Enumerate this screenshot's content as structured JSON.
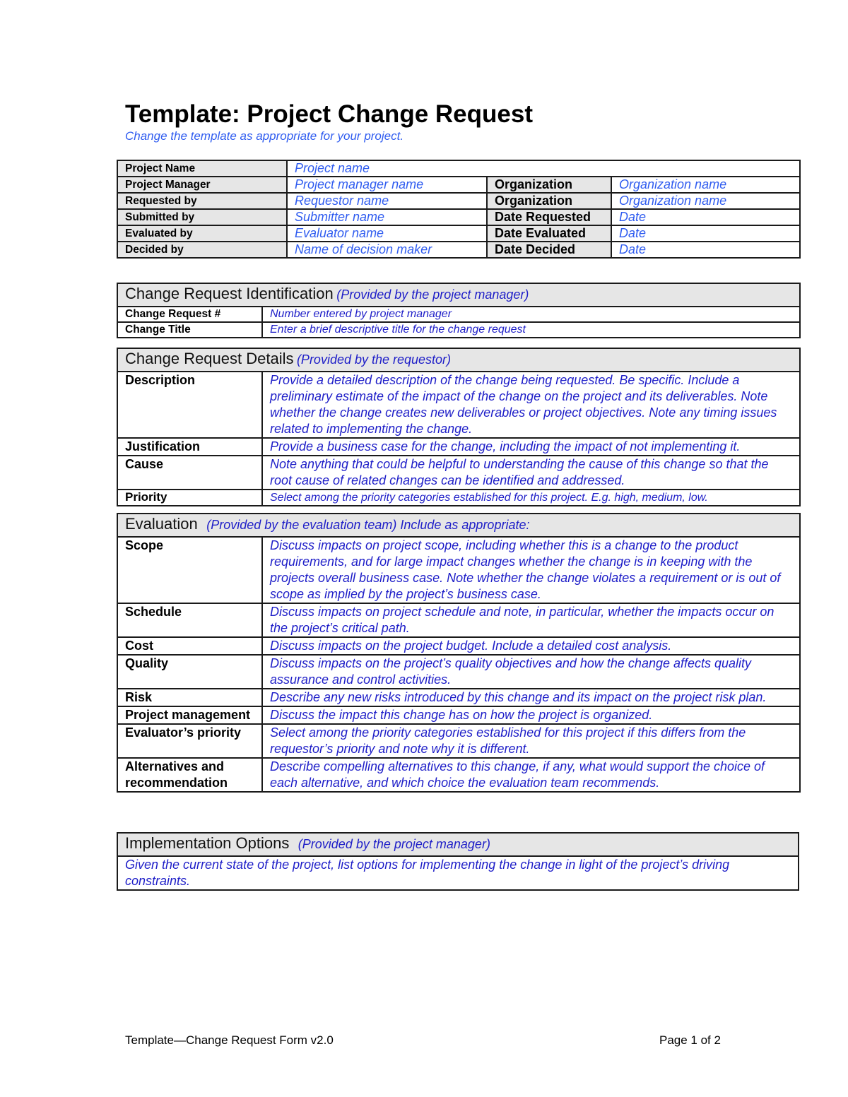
{
  "document": {
    "title": "Template: Project Change Request",
    "subtitle": "Change the template as appropriate for your project."
  },
  "colors": {
    "header_value_blue": "#2f5cf0",
    "section_value_blue": "#1e1ec8",
    "label_background": "#e6e6e6",
    "border": "#1a1a1a"
  },
  "header_table": {
    "project_name_label": "Project Name",
    "project_name_value": "Project name",
    "rows": [
      {
        "label": "Project Manager",
        "value": "Project manager name",
        "label2": "Organization",
        "value2": "Organization name"
      },
      {
        "label": "Requested by",
        "value": "Requestor name",
        "label2": "Organization",
        "value2": "Organization name"
      },
      {
        "label": "Submitted by",
        "value": "Submitter name",
        "label2": "Date Requested",
        "value2": "Date"
      },
      {
        "label": "Evaluated by",
        "value": "Evaluator name",
        "label2": "Date Evaluated",
        "value2": "Date"
      },
      {
        "label": "Decided by",
        "value": "Name of decision maker",
        "label2": "Date Decided",
        "value2": "Date"
      }
    ]
  },
  "sections": {
    "identification": {
      "title": "Change Request Identification",
      "note": "(Provided by the project manager)",
      "rows": [
        {
          "label": "Change Request #",
          "value": "Number entered by project manager"
        },
        {
          "label": "Change Title",
          "value": "Enter a brief descriptive title for the change request"
        }
      ]
    },
    "details": {
      "title": "Change Request Details",
      "note": "(Provided by the requestor)",
      "rows": [
        {
          "label": "Description",
          "value": "Provide a detailed description of the change being requested.  Be specific.  Include a preliminary estimate of the impact of the change on the project and its deliverables.  Note whether the change creates new deliverables or project objectives.  Note any timing issues related to implementing the change."
        },
        {
          "label": "Justification",
          "value": "Provide a business case for the change, including the impact of not implementing it."
        },
        {
          "label": "Cause",
          "value": "Note anything that could be helpful to understanding the cause of this change so that the root cause of related changes can be identified and addressed."
        },
        {
          "label": "Priority",
          "value": "Select among the priority categories established for this project.  E.g. high, medium, low."
        }
      ]
    },
    "evaluation": {
      "title": "Evaluation",
      "note": "(Provided by the evaluation team) Include as appropriate:",
      "rows": [
        {
          "label": "Scope",
          "value": "Discuss impacts on project scope, including whether this is a change to the product requirements, and for large impact changes whether the change is in keeping with the projects overall business case.  Note whether the change violates a requirement or is out of scope as implied by the project’s business case."
        },
        {
          "label": "Schedule",
          "value": "Discuss impacts on project schedule and note, in particular, whether the impacts occur on the project’s critical path."
        },
        {
          "label": "Cost",
          "value": "Discuss impacts on the project budget.  Include a detailed cost analysis."
        },
        {
          "label": "Quality",
          "value": "Discuss impacts on the project’s quality objectives and how the change affects quality assurance and control activities."
        },
        {
          "label": "Risk",
          "value": "Describe any new risks introduced by this change and its impact on the project risk plan."
        },
        {
          "label": "Project management",
          "value": "Discuss the impact this change has on how the project is organized."
        },
        {
          "label": "Evaluator’s priority",
          "value": "Select among the priority categories established for this project if this differs from the requestor’s priority and note why it is different."
        },
        {
          "label": "Alternatives and recommendation",
          "value": "Describe compelling alternatives to this change, if any, what would support the choice of each alternative, and which choice the evaluation team recommends."
        }
      ]
    },
    "implementation": {
      "title": "Implementation Options",
      "note": "(Provided by the project manager)",
      "value": "Given the current state of the project, list options for implementing the change in light of the project’s driving constraints."
    }
  },
  "footer": {
    "left": "Template—Change Request Form v2.0",
    "right": "Page 1 of 2"
  }
}
